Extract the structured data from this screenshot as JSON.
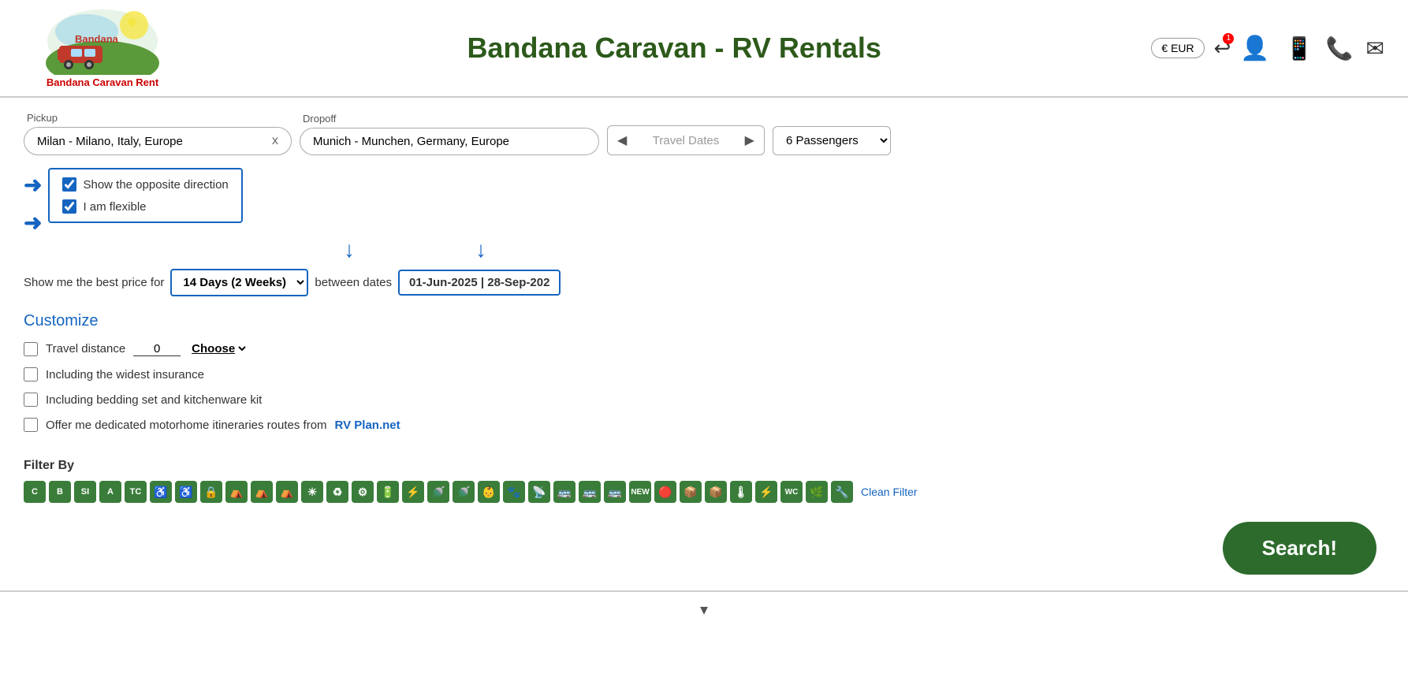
{
  "header": {
    "site_title": "Bandana Caravan - RV Rentals",
    "logo_subtitle": "Bandana Caravan Rent",
    "currency": "€ EUR",
    "currency_dropdown": "▾"
  },
  "search": {
    "pickup_label": "Pickup",
    "dropoff_label": "Dropoff",
    "pickup_value": "Milan - Milano, Italy, Europe",
    "dropoff_value": "Munich - Munchen, Germany, Europe",
    "travel_dates_placeholder": "Travel Dates",
    "passengers_value": "6 Passengers",
    "clear_btn": "x"
  },
  "options": {
    "show_opposite_label": "Show the opposite direction",
    "flexible_label": "I am flexible",
    "best_price_prefix": "Show me the best price for",
    "duration_value": "14 Days (2 Weeks)",
    "between_dates_text": "between dates",
    "dates_value": "01-Jun-2025 | 28-Sep-202"
  },
  "customize": {
    "title": "Customize",
    "travel_distance_label": "Travel distance",
    "travel_distance_value": "0",
    "choose_label": "Choose",
    "insurance_label": "Including the widest insurance",
    "bedding_label": "Including bedding set and kitchenware kit",
    "itinerary_label": "Offer me dedicated motorhome itineraries routes from",
    "rv_plan_link": "RV Plan.net"
  },
  "filter": {
    "title": "Filter By",
    "badges": [
      "C",
      "B",
      "SI",
      "A",
      "TC",
      "♿",
      "♿",
      "🔒",
      "🏕",
      "🏕",
      "🏕",
      "☀",
      "🔄",
      "⚙",
      "🔋",
      "⚡",
      "🚿",
      "🚿",
      "👶",
      "🐾",
      "📡",
      "🚌",
      "🚌",
      "🚌",
      "NEW",
      "🔴",
      "📦",
      "📦",
      "🌡",
      "⚡",
      "WC",
      "🌿",
      "🔧"
    ],
    "clean_filter": "Clean Filter"
  },
  "search_button": {
    "label": "Search!"
  }
}
